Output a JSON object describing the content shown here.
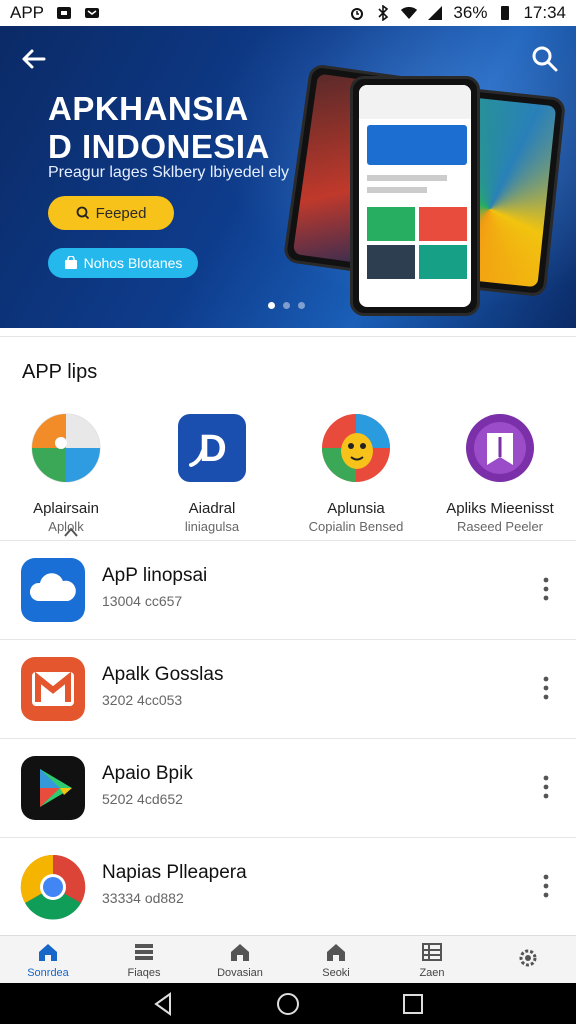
{
  "status_bar": {
    "app_label": "APP",
    "battery": "36%",
    "time": "17:34"
  },
  "hero": {
    "title_line1": "APKHANSIA",
    "title_line2": "D INDONESIA",
    "subtitle": "Preagur lages Sklbery lbiyedel ely",
    "primary_button": "Feeped",
    "secondary_button": "Nohos Blotanes",
    "carousel_pages": 3,
    "carousel_active": 1
  },
  "apps_section": {
    "title": "APP lips",
    "items": [
      {
        "name": "Aplairsain",
        "sub": "Aplolk",
        "icon": "maps-style-icon"
      },
      {
        "name": "Aiadral",
        "sub": "liniagulsa",
        "icon": "d-letter-icon"
      },
      {
        "name": "Aplunsia",
        "sub": "Copialin Bensed",
        "icon": "mascot-icon"
      },
      {
        "name": "Apliks Mieenisst",
        "sub": "Raseed Peeler",
        "icon": "book-flag-icon"
      }
    ]
  },
  "list": {
    "rows": [
      {
        "title": "ApP linopsai",
        "meta": "13004 cc657",
        "icon": "cloud-icon",
        "color": "#1a6fd6"
      },
      {
        "title": "Apalk Gosslas",
        "meta": "3202 4cc053",
        "icon": "m-letter-icon",
        "color": "#e4572e"
      },
      {
        "title": "Apaio Bpik",
        "meta": "5202 4cd652",
        "icon": "play-triangle-icon",
        "color": "#111111"
      },
      {
        "title": "Napias Plleapera",
        "meta": "33334 od882",
        "icon": "chrome-style-icon",
        "color": "#ffffff"
      }
    ]
  },
  "bottom_nav": {
    "items": [
      {
        "label": "Sonrdea",
        "icon": "home-icon",
        "active": true
      },
      {
        "label": "Fiaqes",
        "icon": "list-icon",
        "active": false
      },
      {
        "label": "Dovasian",
        "icon": "home-icon",
        "active": false
      },
      {
        "label": "Seoki",
        "icon": "home-icon",
        "active": false
      },
      {
        "label": "Zaen",
        "icon": "list-icon",
        "active": false
      },
      {
        "label": "",
        "icon": "gear-icon",
        "active": false
      }
    ]
  },
  "colors": {
    "accent": "#1767c9",
    "hero_dark": "#0b2a66",
    "yellow_button": "#f7c21a",
    "cyan_button": "#25b8ec"
  }
}
